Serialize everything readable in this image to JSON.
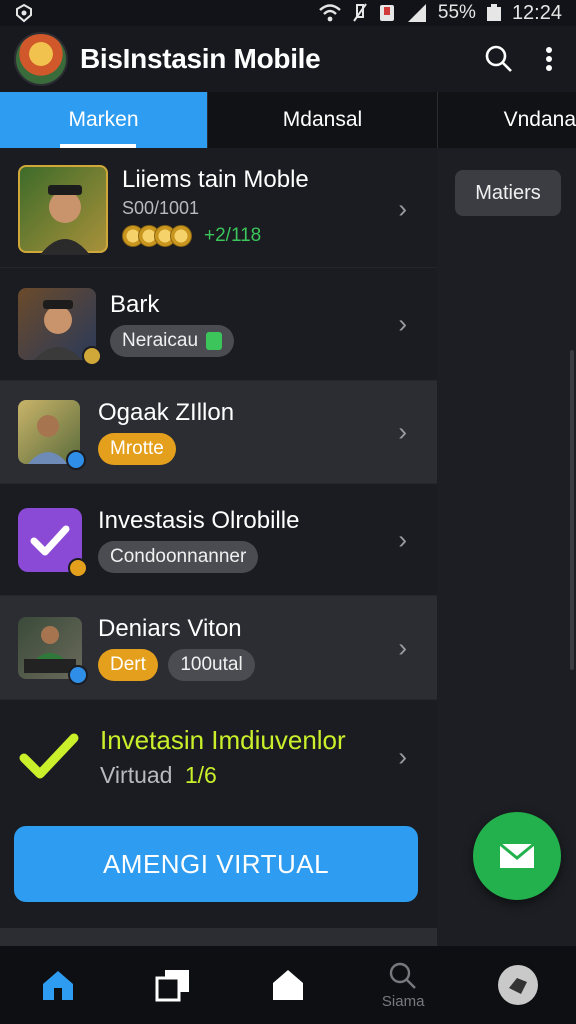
{
  "status_bar": {
    "battery_text": "55%",
    "time": "12:24"
  },
  "app_bar": {
    "title": "BisInstasin Mobile",
    "search_icon": "search-icon",
    "more_icon": "more-vert-icon"
  },
  "tabs": [
    {
      "label": "Marken",
      "active": true
    },
    {
      "label": "Mdansal",
      "active": false
    },
    {
      "label": "Vndana",
      "active": false
    }
  ],
  "list": [
    {
      "title": "Liiems tain Moble",
      "subtitle": "S00/1001",
      "value": "+2/118"
    },
    {
      "title": "Bark",
      "chip": "Neraicau"
    },
    {
      "title": "Ogaak ZIllon",
      "chip": "Mrotte"
    },
    {
      "title": "Investasis Olrobille",
      "chip": "Condoonnanner"
    },
    {
      "title": "Deniars Viton",
      "chip1": "Dert",
      "chip2": "100utal"
    },
    {
      "title": "Invetasin Imdiuvenlor",
      "subtitle": "Virtuad",
      "subtitle_value": "1/6"
    }
  ],
  "cta_label": "AMENGI  VIRTUAL",
  "side_button_label": "Matiers",
  "bottom_nav": [
    {
      "icon": "home-icon",
      "label": ""
    },
    {
      "icon": "windows-icon",
      "label": ""
    },
    {
      "icon": "house-icon",
      "label": ""
    },
    {
      "icon": "search-icon",
      "label": "Siama"
    },
    {
      "icon": "profile-icon",
      "label": ""
    }
  ],
  "colors": {
    "accent_blue": "#2e9cf0",
    "fab_green": "#22b14c",
    "chip_orange": "#e4a01c",
    "highlight_lime": "#c9f02a",
    "value_green": "#3bc55a"
  }
}
